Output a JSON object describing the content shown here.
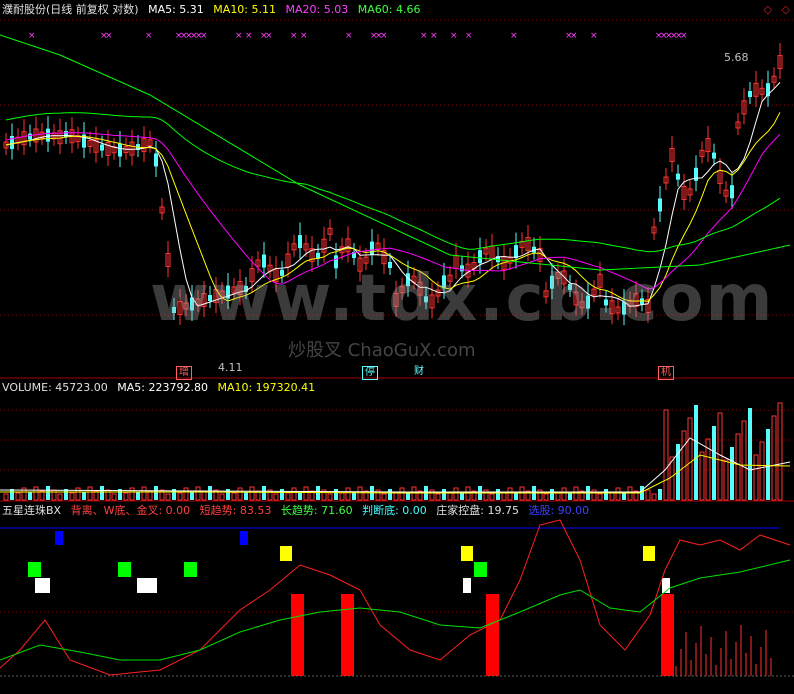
{
  "price_header": {
    "title": "濮耐股份(日线 前复权 对数)",
    "ma5": "MA5: 5.31",
    "ma10": "MA10: 5.11",
    "ma20": "MA20: 5.03",
    "ma60": "MA60: 4.66"
  },
  "volume_header": {
    "title": "VOLUME: 45723.00",
    "ma5": "MA5: 223792.80",
    "ma10": "MA10: 197320.41"
  },
  "indicator_header": {
    "title": "五星连珠BX",
    "divergence": "背离、W底、金叉: 0.00",
    "short_trend": "短趋势: 83.53",
    "long_trend": "长趋势: 71.60",
    "judge_bottom": "判断底: 0.00",
    "dealer_control": "庄家控盘: 19.75",
    "selection": "选股: 90.00"
  },
  "annotations": {
    "high_label": "5.68",
    "low_label": "4.11",
    "zeng": "增",
    "ting": "停",
    "cai": "财",
    "ji": "机"
  },
  "watermark": {
    "main": "www.tdx.cb.com",
    "sub": "炒股叉 ChaoGuX.com"
  },
  "window_icons": [
    "◇",
    "◇"
  ],
  "colors": {
    "up": "#ff3232",
    "down": "#54fcfc",
    "ma5": "#ffffff",
    "ma10": "#ffff00",
    "ma20": "#ff00ff",
    "ma60": "#00ff00",
    "grid": "#800000",
    "blue": "#0000ff"
  }
}
